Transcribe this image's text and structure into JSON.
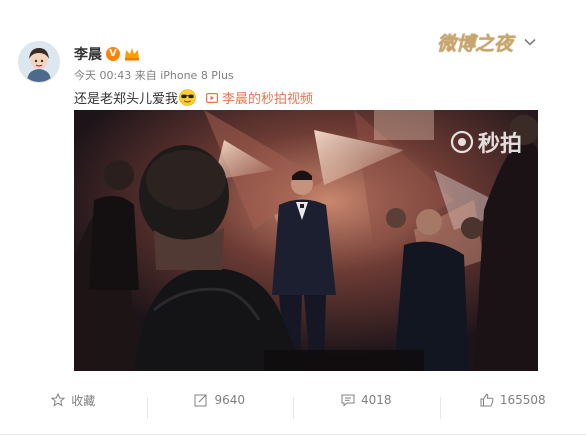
{
  "post": {
    "author": "李晨",
    "vip_badge": "V",
    "meta": "今天 00:43 来自 iPhone 8 Plus",
    "text": "还是老郑头儿爱我",
    "video_link_label": "李晨的秒拍视频",
    "brand": "微博之夜"
  },
  "video": {
    "watermark": "秒拍"
  },
  "actions": {
    "favorite": "收藏",
    "repost": "9640",
    "comment": "4018",
    "like": "165508"
  },
  "icons": {
    "avatar": "cartoon-avatar",
    "vip": "verified-badge-icon",
    "member": "crown-icon",
    "emoji": "sunglasses-emoji-icon",
    "link": "video-link-icon",
    "menu": "chevron-down-icon",
    "favorite": "star-icon",
    "repost": "repost-icon",
    "comment": "comment-icon",
    "like": "thumbs-up-icon"
  },
  "colors": {
    "link": "#eb7350",
    "vip": "#ff8200",
    "brand": "#c9a66b"
  }
}
